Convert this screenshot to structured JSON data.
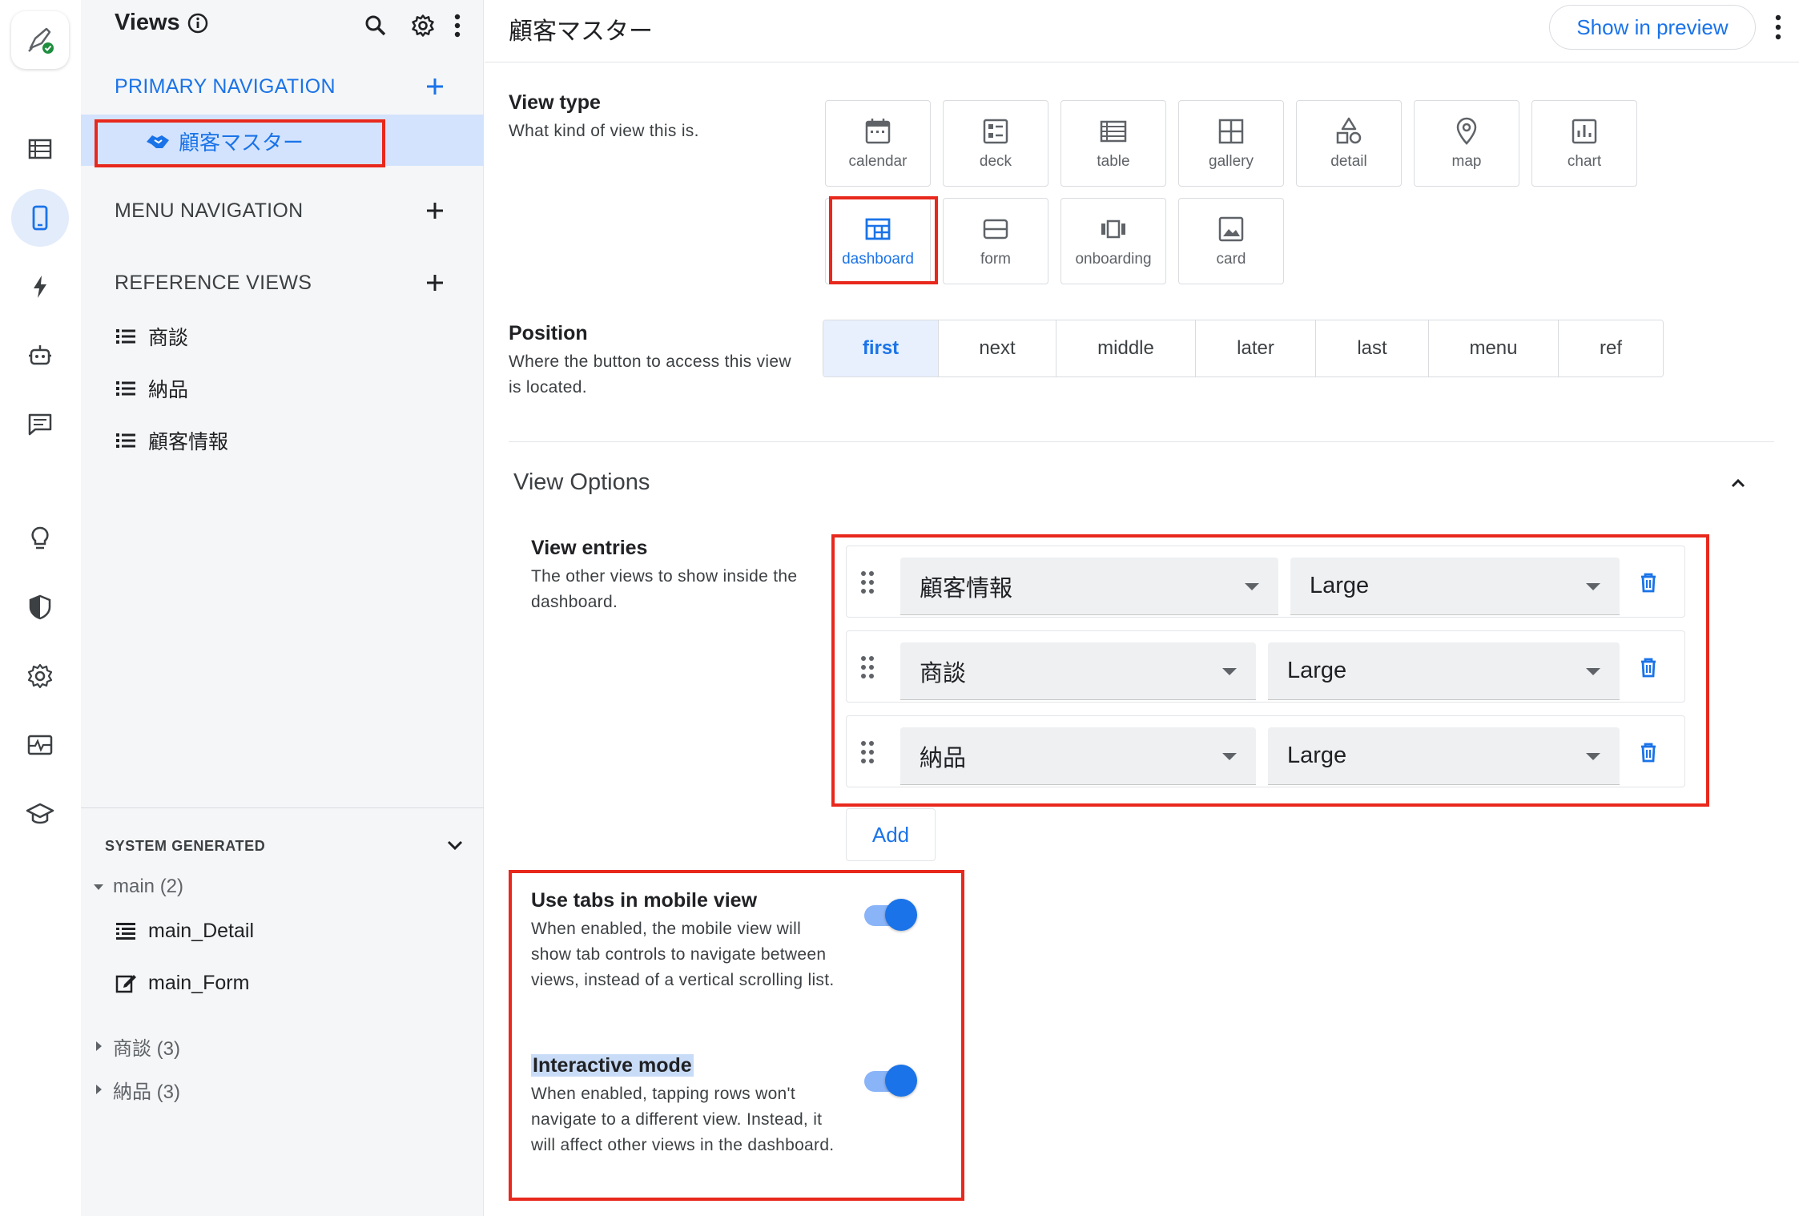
{
  "sidebar_rail": {
    "items": [
      "logo",
      "data",
      "app",
      "automation",
      "bots",
      "chat",
      "ideas",
      "security",
      "settings",
      "monitor",
      "learn"
    ]
  },
  "views_panel": {
    "title": "Views",
    "primary_navigation": {
      "label": "PRIMARY NAVIGATION",
      "items": [
        {
          "label": "顧客マスター"
        }
      ]
    },
    "menu_navigation": {
      "label": "MENU NAVIGATION"
    },
    "reference_views": {
      "label": "REFERENCE VIEWS",
      "items": [
        {
          "label": "商談"
        },
        {
          "label": "納品"
        },
        {
          "label": "顧客情報"
        }
      ]
    },
    "system_generated": {
      "label": "SYSTEM GENERATED",
      "groups": [
        {
          "label": "main (2)",
          "expanded": true,
          "children": [
            {
              "label": "main_Detail"
            },
            {
              "label": "main_Form"
            }
          ]
        },
        {
          "label": "商談 (3)",
          "expanded": false
        },
        {
          "label": "納品 (3)",
          "expanded": false
        }
      ]
    }
  },
  "main": {
    "title": "顧客マスター",
    "show_in_preview": "Show in preview",
    "view_type": {
      "title": "View type",
      "description": "What kind of view this is.",
      "options": [
        {
          "label": "calendar",
          "icon": "calendar-icon"
        },
        {
          "label": "deck",
          "icon": "deck-icon"
        },
        {
          "label": "table",
          "icon": "table-icon"
        },
        {
          "label": "gallery",
          "icon": "gallery-icon"
        },
        {
          "label": "detail",
          "icon": "detail-icon"
        },
        {
          "label": "map",
          "icon": "map-pin-icon"
        },
        {
          "label": "chart",
          "icon": "chart-icon"
        },
        {
          "label": "dashboard",
          "icon": "dashboard-icon"
        },
        {
          "label": "form",
          "icon": "form-icon"
        },
        {
          "label": "onboarding",
          "icon": "onboarding-icon"
        },
        {
          "label": "card",
          "icon": "card-icon"
        }
      ],
      "selected": "dashboard"
    },
    "position": {
      "title": "Position",
      "description": "Where the button to access this view is located.",
      "options": [
        {
          "label": "first"
        },
        {
          "label": "next"
        },
        {
          "label": "middle"
        },
        {
          "label": "later"
        },
        {
          "label": "last"
        },
        {
          "label": "menu"
        },
        {
          "label": "ref"
        }
      ],
      "selected": "first"
    },
    "view_options": {
      "title": "View Options",
      "entries": {
        "title": "View entries",
        "description": "The other views to show inside the dashboard.",
        "rows": [
          {
            "view": "顧客情報",
            "size": "Large"
          },
          {
            "view": "商談",
            "size": "Large"
          },
          {
            "view": "納品",
            "size": "Large"
          }
        ],
        "add_label": "Add"
      },
      "use_tabs": {
        "title": "Use tabs in mobile view",
        "description": "When enabled, the mobile view will show tab controls to navigate between views, instead of a vertical scrolling list.",
        "enabled": true
      },
      "interactive_mode": {
        "title": "Interactive mode",
        "description": "When enabled, tapping rows won't navigate to a different view. Instead, it will affect other views in the dashboard.",
        "enabled": true
      }
    }
  },
  "colors": {
    "accent": "#1a73e8",
    "highlight_border": "#e8281c",
    "panel_bg": "#f5f6f7"
  }
}
